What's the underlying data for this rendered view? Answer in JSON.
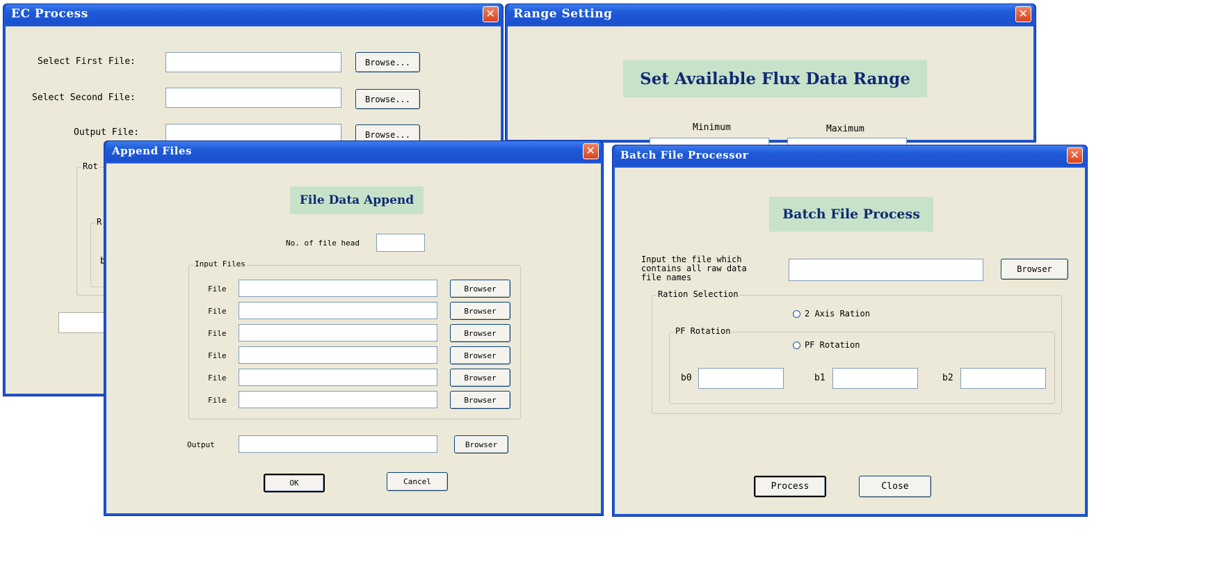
{
  "ec_process": {
    "title": "EC Process",
    "first_file_label": "Select First File:",
    "second_file_label": "Select Second File:",
    "output_file_label": "Output File:",
    "browse_label": "Browse...",
    "group_partial_label": "Rot",
    "inner_group_partial": "R",
    "inner_label_partial": "b"
  },
  "range_setting": {
    "title": "Range Setting",
    "banner": "Set Available Flux Data Range",
    "minimum_label": "Minimum",
    "maximum_label": "Maximum"
  },
  "append_files": {
    "title": "Append Files",
    "banner": "File Data Append",
    "file_head_label": "No. of file head",
    "input_group_label": "Input Files",
    "file_rows": [
      {
        "label": "File",
        "button": "Browser"
      },
      {
        "label": "File",
        "button": "Browser"
      },
      {
        "label": "File",
        "button": "Browser"
      },
      {
        "label": "File",
        "button": "Browser"
      },
      {
        "label": "File",
        "button": "Browser"
      },
      {
        "label": "File",
        "button": "Browser"
      }
    ],
    "output_label": "Output",
    "output_button": "Browser",
    "ok_label": "OK",
    "cancel_label": "Cancel"
  },
  "batch_processor": {
    "title": "Batch File Processor",
    "banner": "Batch File Process",
    "input_label": "Input the file which contains all raw data file names",
    "browse_label": "Browser",
    "ration_group_label": "Ration Selection",
    "axis_option": "2 Axis Ration",
    "pf_group_label": "PF Rotation",
    "pf_option": "PF Rotation",
    "b0_label": "b0",
    "b1_label": "b1",
    "b2_label": "b2",
    "process_label": "Process",
    "close_label": "Close"
  }
}
